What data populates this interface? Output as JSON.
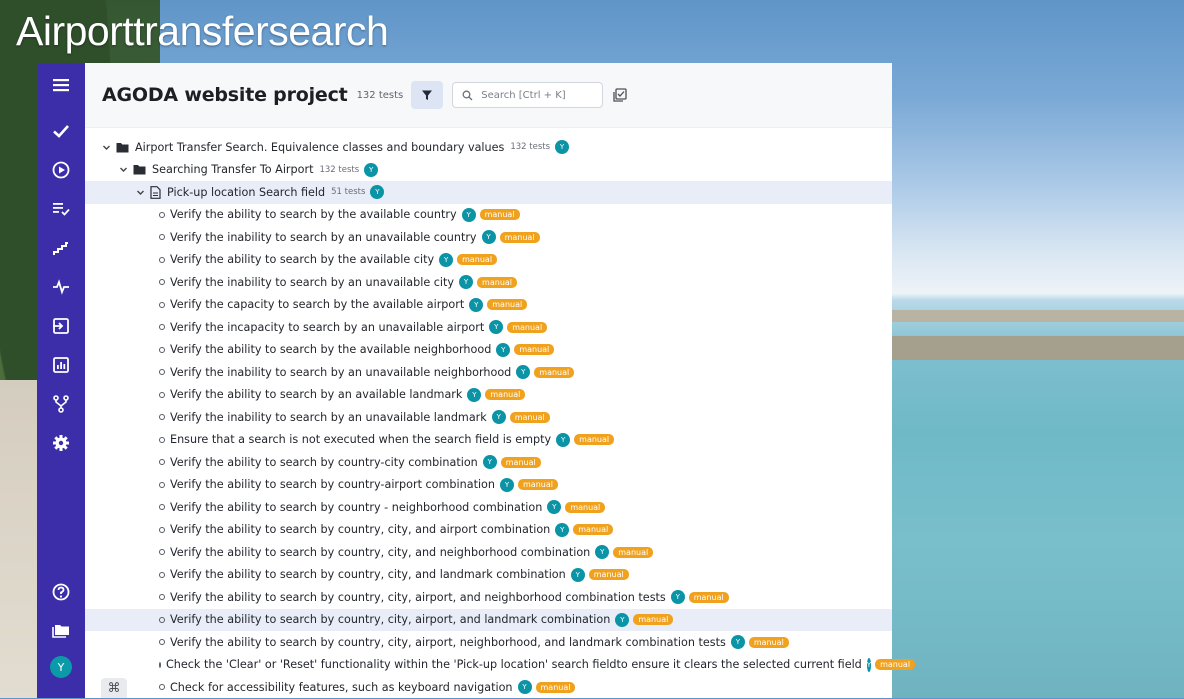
{
  "slide_title": "Airporttransfersearch",
  "sidebar": {
    "items": [
      {
        "icon": "menu-icon"
      },
      {
        "icon": "check-icon"
      },
      {
        "icon": "play-icon"
      },
      {
        "icon": "checklist-icon"
      },
      {
        "icon": "steps-icon"
      },
      {
        "icon": "pulse-icon"
      },
      {
        "icon": "import-icon"
      },
      {
        "icon": "chart-icon"
      },
      {
        "icon": "branch-icon"
      },
      {
        "icon": "gear-icon"
      }
    ],
    "bottom": [
      {
        "icon": "help-icon"
      },
      {
        "icon": "folders-icon"
      }
    ],
    "avatar": "Y"
  },
  "header": {
    "project_title": "AGODA website project",
    "test_count": "132 tests",
    "search_placeholder": "Search [Ctrl + K]"
  },
  "tree": {
    "root": {
      "label": "Airport Transfer Search. Equivalence classes and boundary values",
      "count": "132 tests",
      "owner": "Y"
    },
    "group": {
      "label": "Searching Transfer To Airport",
      "count": "132 tests",
      "owner": "Y"
    },
    "suite": {
      "label": "Pick-up location Search field",
      "count": "51 tests",
      "owner": "Y"
    },
    "tests": [
      {
        "label": "Verify the ability to search by the available country",
        "owner": "Y",
        "tag": "manual"
      },
      {
        "label": "Verify the inability to search by an unavailable country",
        "owner": "Y",
        "tag": "manual"
      },
      {
        "label": "Verify the ability to search by the available city",
        "owner": "Y",
        "tag": "manual"
      },
      {
        "label": "Verify the inability to search by an unavailable city",
        "owner": "Y",
        "tag": "manual"
      },
      {
        "label": "Verify the capacity to search by the available airport",
        "owner": "Y",
        "tag": "manual"
      },
      {
        "label": "Verify the incapacity to search by an unavailable airport",
        "owner": "Y",
        "tag": "manual"
      },
      {
        "label": "Verify the ability to search by the available neighborhood",
        "owner": "Y",
        "tag": "manual"
      },
      {
        "label": "Verify the inability to search by an unavailable neighborhood",
        "owner": "Y",
        "tag": "manual"
      },
      {
        "label": "Verify the ability to search by an available landmark",
        "owner": "Y",
        "tag": "manual"
      },
      {
        "label": "Verify the inability to search by an unavailable landmark",
        "owner": "Y",
        "tag": "manual"
      },
      {
        "label": "Ensure that a search is not executed when the search field is empty",
        "owner": "Y",
        "tag": "manual"
      },
      {
        "label": "Verify the ability to search by country-city combination",
        "owner": "Y",
        "tag": "manual"
      },
      {
        "label": "Verify the ability to search by country-airport combination",
        "owner": "Y",
        "tag": "manual"
      },
      {
        "label": "Verify the ability to search by country - neighborhood combination",
        "owner": "Y",
        "tag": "manual"
      },
      {
        "label": "Verify the ability to search by country, city, and airport combination",
        "owner": "Y",
        "tag": "manual"
      },
      {
        "label": "Verify the ability to search by country, city, and neighborhood combination",
        "owner": "Y",
        "tag": "manual"
      },
      {
        "label": "Verify the ability to search by country, city, and landmark combination",
        "owner": "Y",
        "tag": "manual"
      },
      {
        "label": "Verify the ability to search by country, city, airport, and neighborhood combination tests",
        "owner": "Y",
        "tag": "manual"
      },
      {
        "label": "Verify the ability to search by country, city, airport, and landmark combination",
        "owner": "Y",
        "tag": "manual"
      },
      {
        "label": "Verify the ability to search by country, city, airport, neighborhood, and landmark combination tests",
        "owner": "Y",
        "tag": "manual"
      },
      {
        "label": "Check the 'Clear' or 'Reset' functionality within the 'Pick-up location' search fieldto ensure it clears the selected current field",
        "owner": "Y",
        "tag": "manual"
      },
      {
        "label": "Check for accessibility features, such as keyboard navigation",
        "owner": "Y",
        "tag": "manual"
      }
    ]
  },
  "footer": {
    "shortcut_key": "⌘"
  },
  "colors": {
    "sidebar": "#3b2ea8",
    "owner_badge": "#0b93a6",
    "manual_tag": "#f0a21f",
    "selected_row": "#e9edf7"
  }
}
